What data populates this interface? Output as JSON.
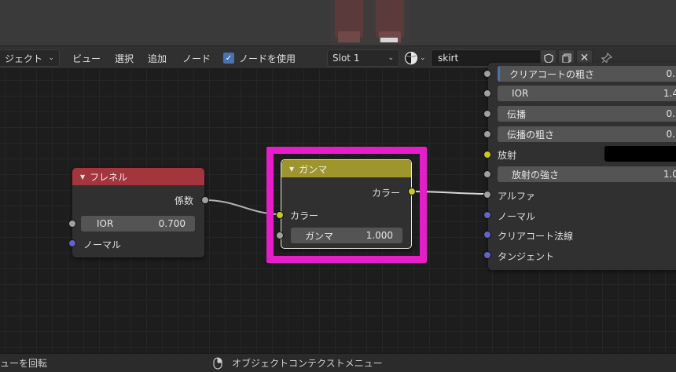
{
  "header": {
    "view_menu_partial": "ジェクト",
    "menus": [
      "ビュー",
      "選択",
      "追加",
      "ノード"
    ],
    "use_nodes_label": "ノードを使用",
    "slot_label": "Slot 1",
    "material_name": "skirt"
  },
  "nodes": {
    "fresnel": {
      "title": "フレネル",
      "output_label": "係数",
      "ior_label": "IOR",
      "ior_value": "0.700",
      "normal_label": "ノーマル"
    },
    "gamma": {
      "title": "ガンマ",
      "output_label": "カラー",
      "input_color_label": "カラー",
      "gamma_label": "ガンマ",
      "gamma_value": "1.000"
    },
    "bsdf": {
      "rows": {
        "clearcoat_rough": {
          "label": "クリアコートの粗さ",
          "value": "0."
        },
        "ior": {
          "label": "IOR",
          "value": "1.4"
        },
        "transmission": {
          "label": "伝播",
          "value": "0."
        },
        "transmission_rough": {
          "label": "伝播の粗さ",
          "value": "0."
        },
        "emission": {
          "label": "放射"
        },
        "emission_strength": {
          "label": "放射の強さ",
          "value": "1.0"
        },
        "alpha": {
          "label": "アルファ"
        },
        "normal": {
          "label": "ノーマル"
        },
        "clearcoat_normal": {
          "label": "クリアコート法線"
        },
        "tangent": {
          "label": "タンジェント"
        }
      }
    }
  },
  "status_bar": {
    "left_text": "ューを回転",
    "center_text": "オブジェクトコンテクストメニュー"
  },
  "colors": {
    "fresnel_header": "#a3353d",
    "gamma_header": "#9f952d",
    "highlight": "#e61ec9",
    "socket_color": "#c7c729",
    "socket_float": "#a1a1a1",
    "socket_vector": "#6363c7"
  },
  "icons": {
    "use_nodes_check": "checkmark-icon",
    "material_preview": "material-sphere-icon",
    "fake_user": "shield-icon",
    "duplicate": "duplicate-icon",
    "unlink": "close-icon",
    "pin": "pin-icon",
    "mouse": "mouse-icon"
  }
}
